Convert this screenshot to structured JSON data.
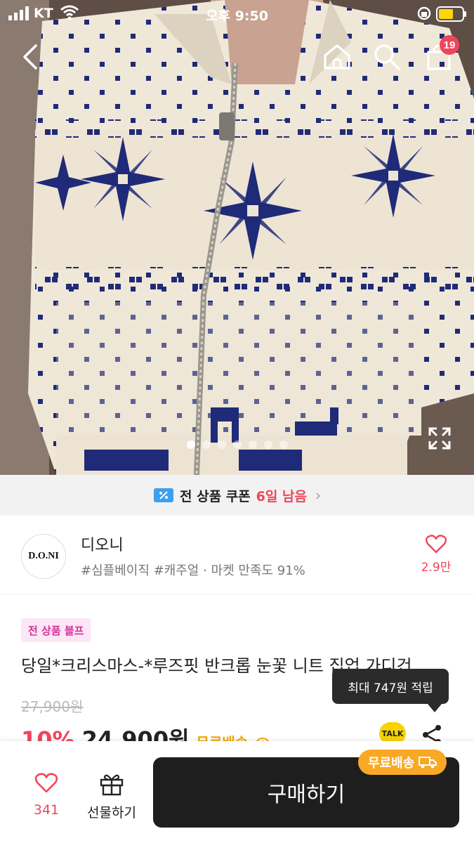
{
  "status": {
    "carrier": "KT",
    "time": "오후 9:50"
  },
  "nav": {
    "cart_count": "19"
  },
  "coupon": {
    "text": "전 상품 쿠폰",
    "remain": "6일 남음"
  },
  "shop": {
    "logo": "D.O.NI",
    "name": "디오니",
    "tags": "#심플베이직 #캐주얼 · 마켓 만족도 91%",
    "likes": "2.9만"
  },
  "product": {
    "badge": "전 상품 블프",
    "title": "당일*크리스마스-*루즈핏 반크롭 눈꽃 니트 집업 가디건",
    "original_price": "27,900원",
    "discount": "10%",
    "price": "24,900원",
    "shipping": "무료배송",
    "talk": "TALK"
  },
  "tooltip": "최대 747원 적립",
  "bottom": {
    "likes": "341",
    "gift": "선물하기",
    "buy": "구매하기",
    "ship_pill": "무료배송"
  },
  "colors": {
    "accent": "#f1445a",
    "dark_button": "#1e1e1e",
    "ship_orange": "#f9a825",
    "knit_navy": "#1f2a78"
  }
}
